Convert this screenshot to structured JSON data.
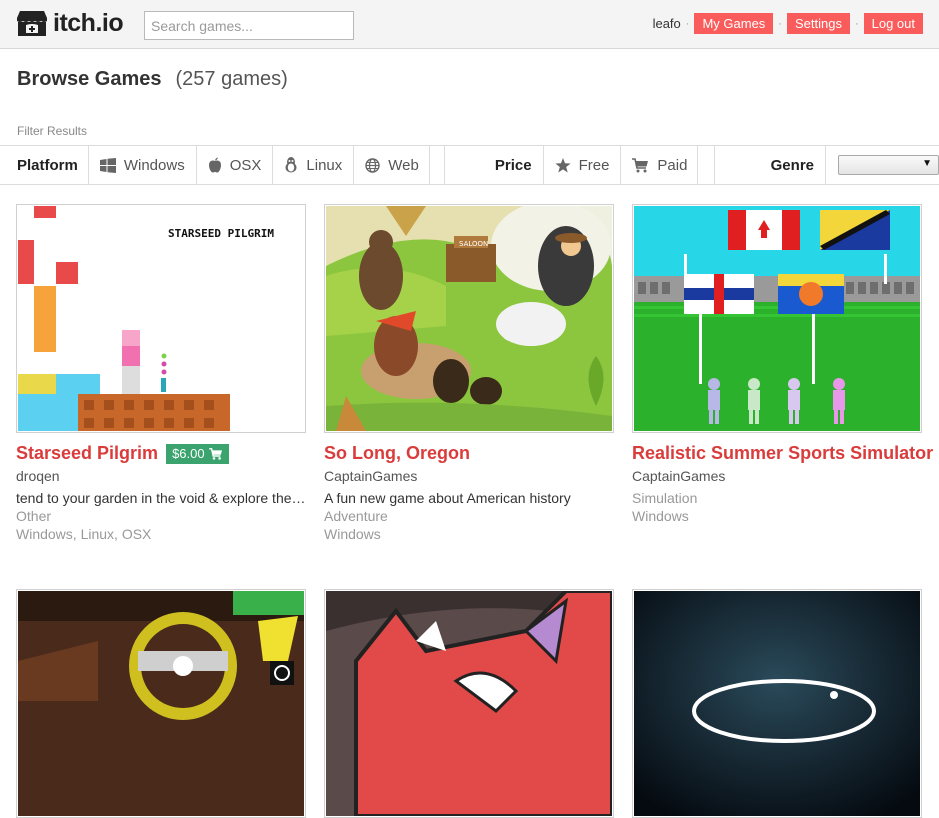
{
  "header": {
    "logo_text": "itch.io",
    "search_placeholder": "Search games...",
    "username": "leafo",
    "my_games": "My Games",
    "settings": "Settings",
    "logout": "Log out"
  },
  "page": {
    "title": "Browse Games",
    "count": "(257 games)",
    "filter_label": "Filter Results"
  },
  "filters": {
    "platform_label": "Platform",
    "platforms": [
      "Windows",
      "OSX",
      "Linux",
      "Web"
    ],
    "price_label": "Price",
    "prices": [
      "Free",
      "Paid"
    ],
    "genre_label": "Genre",
    "genre_selected": ""
  },
  "games": [
    {
      "title": "Starseed Pilgrim",
      "price": "$6.00",
      "author": "droqen",
      "description": "tend to your garden in the void & explore the…",
      "genre": "Other",
      "platforms": "Windows, Linux, OSX",
      "thumb_text": "STARSEED PILGRIM"
    },
    {
      "title": "So Long, Oregon",
      "author": "CaptainGames",
      "description": "A fun new game about American history",
      "genre": "Adventure",
      "platforms": "Windows",
      "thumb_text": "SALOON"
    },
    {
      "title": "Realistic Summer Sports Simulator",
      "author": "CaptainGames",
      "genre": "Simulation",
      "platforms": "Windows"
    }
  ],
  "colors": {
    "accent": "#fa5c5c",
    "title_link": "#da3c3c",
    "price_badge": "#3ba36d"
  }
}
